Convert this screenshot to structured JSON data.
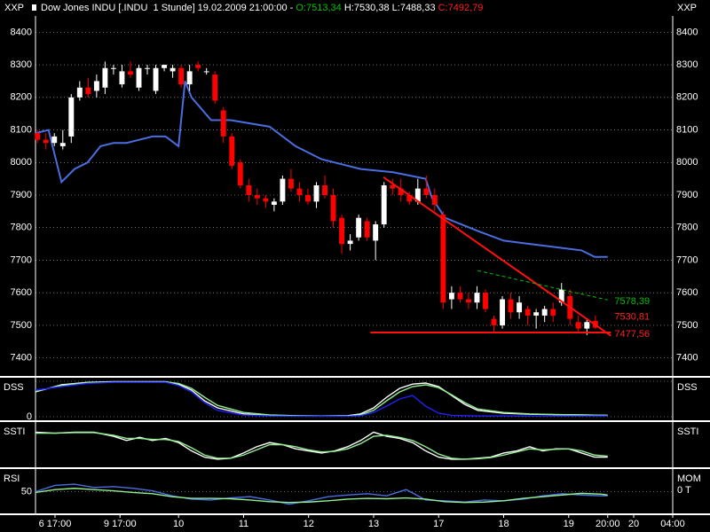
{
  "header": {
    "title": "Dow Jones INDU [.INDU  1 Stunde] 19.02.2009 21:00:00 - ",
    "open": "O:7513,34",
    "high": " H:7530,38",
    "low": " L:7488,33",
    "close": " C:7492,79",
    "open_color": "#00c000",
    "close_color": "#ff2020"
  },
  "axis_tag": "XXP",
  "colors": {
    "background": "#000000",
    "candle_up": "#ffffff",
    "candle_down": "#ff0000",
    "blue_line": "#4a6ee0",
    "trend": "#ff1010",
    "green": "#90ee90",
    "grid": "#ffffff"
  },
  "chart_data": [
    {
      "type": "candlestick",
      "panel": "price",
      "title": "Dow Jones INDU [.INDU  1 Stunde] 19.02.2009 21:00:00",
      "ylim": [
        7350,
        8450
      ],
      "yticks": [
        7400,
        7500,
        7600,
        7700,
        7800,
        7900,
        8000,
        8100,
        8200,
        8300,
        8400
      ],
      "ytick_labels": [
        "7400",
        "7500",
        "7600",
        "7700",
        "7800",
        "7900",
        "8000",
        "8100",
        "8200",
        "8300",
        "8400"
      ],
      "xlim": [
        0,
        98
      ],
      "x_ticks": [
        {
          "x": 3,
          "label": "6 17:00"
        },
        {
          "x": 13,
          "label": "9 17:00"
        },
        {
          "x": 22,
          "label": "10"
        },
        {
          "x": 32,
          "label": "11"
        },
        {
          "x": 42,
          "label": "12"
        },
        {
          "x": 52,
          "label": "13"
        },
        {
          "x": 62,
          "label": "17"
        },
        {
          "x": 72,
          "label": "18"
        },
        {
          "x": 82,
          "label": "19"
        },
        {
          "x": 88,
          "label": "20:00"
        },
        {
          "x": 92,
          "label": "20"
        },
        {
          "x": 98,
          "label": "04:00"
        }
      ],
      "candles": [
        [
          8090,
          8100,
          8060,
          8070
        ],
        [
          8070,
          8090,
          8040,
          8060
        ],
        [
          8060,
          8090,
          8050,
          8080
        ],
        [
          8050,
          8100,
          8040,
          8060
        ],
        [
          8080,
          8210,
          8060,
          8200
        ],
        [
          8200,
          8250,
          8190,
          8230
        ],
        [
          8230,
          8260,
          8200,
          8210
        ],
        [
          8220,
          8270,
          8200,
          8250
        ],
        [
          8230,
          8310,
          8210,
          8290
        ],
        [
          8290,
          8300,
          8270,
          8290
        ],
        [
          8240,
          8300,
          8230,
          8280
        ],
        [
          8280,
          8310,
          8260,
          8270
        ],
        [
          8230,
          8300,
          8220,
          8290
        ],
        [
          8290,
          8300,
          8270,
          8290
        ],
        [
          8220,
          8300,
          8210,
          8290
        ],
        [
          8290,
          8300,
          8280,
          8300
        ],
        [
          8280,
          8300,
          8260,
          8290
        ],
        [
          8290,
          8300,
          8230,
          8240
        ],
        [
          8240,
          8300,
          8220,
          8280
        ],
        [
          8300,
          8310,
          8280,
          8290
        ],
        [
          8280,
          8290,
          8270,
          8280
        ],
        [
          8270,
          8280,
          8180,
          8190
        ],
        [
          8160,
          8170,
          8060,
          8080
        ],
        [
          8080,
          8090,
          7980,
          7990
        ],
        [
          8000,
          8010,
          7920,
          7930
        ],
        [
          7930,
          7950,
          7880,
          7900
        ],
        [
          7900,
          7920,
          7870,
          7890
        ],
        [
          7890,
          7900,
          7860,
          7880
        ],
        [
          7870,
          7890,
          7850,
          7880
        ],
        [
          7880,
          7960,
          7870,
          7950
        ],
        [
          7950,
          7980,
          7910,
          7920
        ],
        [
          7920,
          7940,
          7880,
          7900
        ],
        [
          7900,
          7920,
          7870,
          7880
        ],
        [
          7880,
          7940,
          7860,
          7930
        ],
        [
          7930,
          7960,
          7890,
          7900
        ],
        [
          7900,
          7920,
          7800,
          7820
        ],
        [
          7830,
          7840,
          7720,
          7750
        ],
        [
          7750,
          7780,
          7730,
          7760
        ],
        [
          7770,
          7840,
          7760,
          7830
        ],
        [
          7820,
          7830,
          7760,
          7770
        ],
        [
          7760,
          7820,
          7700,
          7810
        ],
        [
          7810,
          7940,
          7800,
          7930
        ],
        [
          7930,
          7950,
          7900,
          7920
        ],
        [
          7920,
          7950,
          7880,
          7900
        ],
        [
          7900,
          7910,
          7870,
          7880
        ],
        [
          7880,
          7950,
          7870,
          7920
        ],
        [
          7920,
          7960,
          7890,
          7900
        ],
        [
          7900,
          7920,
          7850,
          7870
        ],
        [
          7840,
          7850,
          7550,
          7570
        ],
        [
          7580,
          7620,
          7550,
          7600
        ],
        [
          7600,
          7620,
          7570,
          7580
        ],
        [
          7580,
          7600,
          7550,
          7570
        ],
        [
          7570,
          7620,
          7550,
          7600
        ],
        [
          7600,
          7610,
          7540,
          7550
        ],
        [
          7520,
          7530,
          7480,
          7500
        ],
        [
          7500,
          7590,
          7490,
          7580
        ],
        [
          7580,
          7600,
          7520,
          7540
        ],
        [
          7540,
          7590,
          7520,
          7570
        ],
        [
          7550,
          7560,
          7500,
          7530
        ],
        [
          7530,
          7550,
          7490,
          7540
        ],
        [
          7530,
          7560,
          7510,
          7550
        ],
        [
          7550,
          7570,
          7510,
          7530
        ],
        [
          7570,
          7630,
          7560,
          7610
        ],
        [
          7590,
          7610,
          7500,
          7520
        ],
        [
          7510,
          7530,
          7480,
          7490
        ],
        [
          7490,
          7520,
          7470,
          7510
        ],
        [
          7513.34,
          7530.38,
          7488.33,
          7492.79
        ]
      ],
      "candle_x_start": 0.3,
      "candle_x_step": 1.3,
      "series": [
        {
          "name": "",
          "color": "#4a6ee0",
          "x": [
            0,
            2,
            4,
            6,
            8,
            10,
            12,
            14,
            16,
            18,
            20,
            22,
            23,
            24,
            27,
            30,
            36,
            40,
            44,
            50,
            55,
            60,
            61,
            63,
            68,
            72,
            76,
            80,
            84,
            86,
            88
          ],
          "values": [
            8090,
            8100,
            7940,
            7980,
            8000,
            8050,
            8060,
            8060,
            8070,
            8080,
            8080,
            8050,
            8250,
            8200,
            8130,
            8130,
            8110,
            8050,
            8010,
            7980,
            7970,
            7950,
            7890,
            7830,
            7790,
            7760,
            7750,
            7740,
            7730,
            7710,
            7710
          ]
        }
      ],
      "trend_lines": [
        {
          "x": [
            53.5,
            88.5
          ],
          "y": [
            7955,
            7468
          ],
          "color": "#ff1010"
        },
        {
          "x": [
            51.5,
            88.5
          ],
          "y": [
            7478,
            7478
          ],
          "color": "#ff1010"
        },
        {
          "x": [
            68,
            88
          ],
          "y": [
            7668,
            7578
          ],
          "color": "#00c000",
          "dashed": true
        }
      ],
      "level_labels": [
        {
          "text": "7578,39",
          "value": 7578.39,
          "color": "#00c000"
        },
        {
          "text": "7530,81",
          "value": 7530.81,
          "color": "#ff2020"
        },
        {
          "text": "7477,56",
          "value": 7477.56,
          "color": "#ff2020"
        }
      ]
    },
    {
      "type": "line",
      "panel": "DSS",
      "title": "DSS",
      "ylim": [
        -5,
        105
      ],
      "yticks": [
        0
      ],
      "ytick_labels": [
        "0"
      ],
      "hgrid": [
        0,
        100
      ],
      "x": [
        0,
        4,
        8,
        12,
        16,
        20,
        22,
        24,
        26,
        28,
        32,
        36,
        40,
        44,
        48,
        50,
        52,
        54,
        56,
        58,
        60,
        62,
        64,
        66,
        68,
        72,
        76,
        80,
        84,
        88
      ],
      "series": [
        {
          "name": "",
          "color": "#ffffff",
          "values": [
            70,
            90,
            97,
            99,
            99,
            99,
            92,
            75,
            45,
            25,
            8,
            3,
            2,
            2,
            3,
            8,
            25,
            55,
            80,
            92,
            95,
            85,
            60,
            35,
            18,
            10,
            7,
            6,
            5,
            4
          ]
        },
        {
          "name": "",
          "color": "#90ee90",
          "values": [
            72,
            88,
            96,
            98,
            98,
            98,
            94,
            80,
            55,
            32,
            12,
            5,
            3,
            2,
            2,
            5,
            18,
            45,
            70,
            85,
            90,
            82,
            62,
            40,
            22,
            12,
            8,
            6,
            5,
            4
          ]
        },
        {
          "name": "",
          "color": "#2020ff",
          "values": [
            75,
            85,
            94,
            97,
            97,
            97,
            88,
            70,
            40,
            18,
            5,
            2,
            1,
            1,
            1,
            3,
            12,
            30,
            50,
            60,
            30,
            10,
            4,
            3,
            2,
            2,
            2,
            2,
            2,
            2
          ]
        }
      ]
    },
    {
      "type": "line",
      "panel": "SSTI",
      "title": "SSTI",
      "ylim": [
        -100,
        100
      ],
      "yticks": [],
      "ytick_labels": [],
      "x": [
        0,
        3,
        6,
        9,
        12,
        14,
        16,
        18,
        20,
        22,
        24,
        26,
        28,
        30,
        32,
        34,
        36,
        38,
        40,
        42,
        44,
        46,
        48,
        50,
        52,
        54,
        56,
        58,
        60,
        62,
        64,
        66,
        68,
        70,
        72,
        74,
        76,
        78,
        80,
        82,
        84,
        86,
        88
      ],
      "series": [
        {
          "name": "",
          "color": "#ffffff",
          "values": [
            60,
            55,
            60,
            60,
            40,
            20,
            35,
            20,
            30,
            10,
            -30,
            -60,
            -70,
            -65,
            -40,
            -10,
            10,
            0,
            -20,
            -30,
            -40,
            -30,
            -10,
            20,
            60,
            40,
            30,
            10,
            -30,
            -60,
            -70,
            -70,
            -65,
            -60,
            -40,
            -30,
            -10,
            -30,
            -20,
            -20,
            -40,
            -60,
            -60
          ]
        },
        {
          "name": "",
          "color": "#90ee90",
          "values": [
            55,
            55,
            58,
            58,
            45,
            30,
            30,
            25,
            25,
            15,
            -15,
            -50,
            -65,
            -65,
            -50,
            -25,
            0,
            0,
            -10,
            -25,
            -35,
            -32,
            -20,
            5,
            40,
            45,
            35,
            20,
            -10,
            -45,
            -65,
            -70,
            -68,
            -62,
            -50,
            -35,
            -20,
            -25,
            -22,
            -20,
            -30,
            -50,
            -55
          ]
        }
      ]
    },
    {
      "type": "line",
      "panel": "RSI",
      "title": "RSI",
      "ylim": [
        0,
        100
      ],
      "yticks": [
        50
      ],
      "ytick_labels": [
        "50"
      ],
      "hgrid": [
        50
      ],
      "right_labels": [
        "MOM",
        "0 T"
      ],
      "x": [
        0,
        3,
        6,
        9,
        12,
        15,
        18,
        21,
        24,
        27,
        30,
        33,
        36,
        39,
        42,
        45,
        48,
        51,
        54,
        57,
        60,
        63,
        66,
        69,
        72,
        75,
        78,
        81,
        84,
        87,
        88
      ],
      "series": [
        {
          "name": "",
          "color": "#4a6ee0",
          "values": [
            50,
            65,
            68,
            60,
            62,
            58,
            52,
            40,
            32,
            30,
            35,
            38,
            30,
            20,
            28,
            38,
            42,
            45,
            40,
            55,
            30,
            28,
            25,
            30,
            28,
            32,
            40,
            45,
            42,
            40,
            40
          ]
        },
        {
          "name": "",
          "color": "#90ee90",
          "values": [
            48,
            55,
            58,
            55,
            52,
            48,
            45,
            38,
            34,
            34,
            33,
            30,
            26,
            24,
            25,
            28,
            32,
            34,
            33,
            35,
            32,
            26,
            24,
            25,
            28,
            34,
            38,
            42,
            46,
            44,
            42
          ]
        }
      ]
    }
  ]
}
